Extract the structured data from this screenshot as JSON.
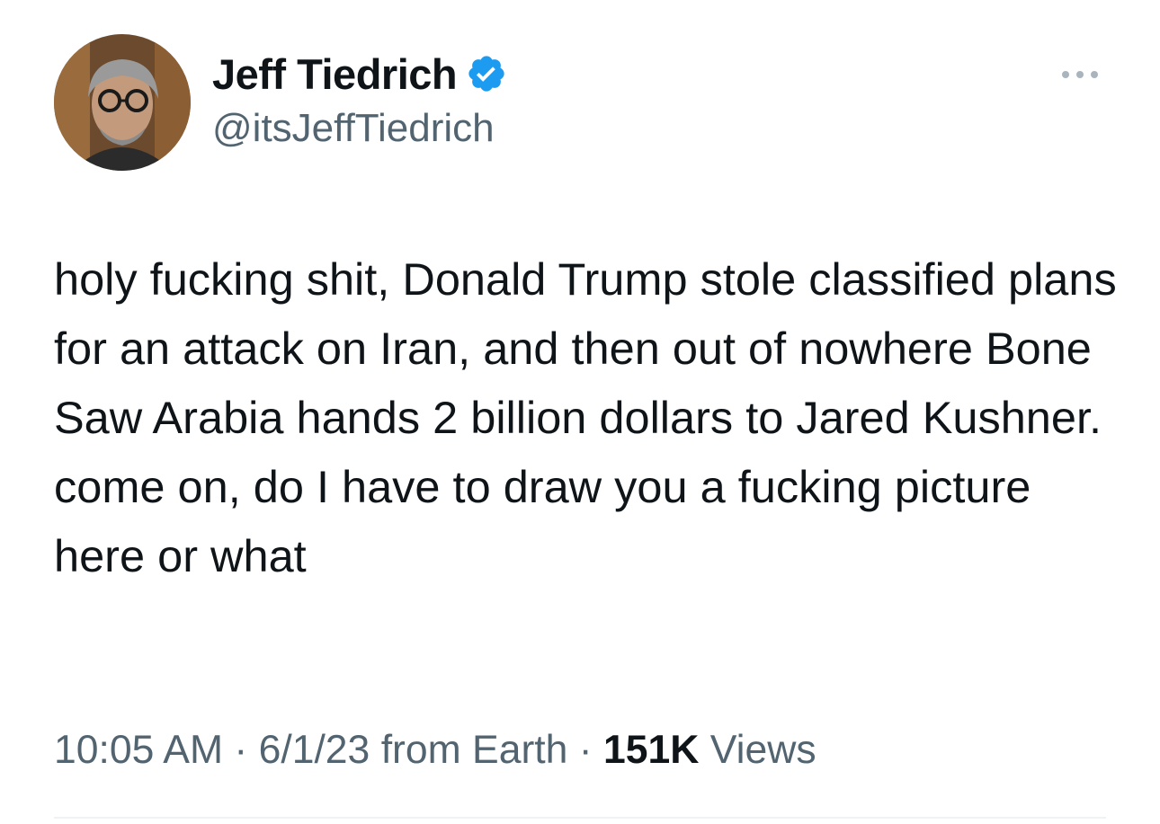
{
  "author": {
    "display_name": "Jeff Tiedrich",
    "handle": "@itsJeffTiedrich",
    "verified_badge_icon": "verified-check-icon",
    "verified_color": "#1d9bf0"
  },
  "tweet": {
    "text": "holy fucking shit, Donald Trump stole classified plans for an attack on Iran, and then out of nowhere Bone Saw Arabia hands 2 billion dollars to Jared Kushner. come on, do I have to draw you a fucking picture here or what"
  },
  "meta": {
    "time": "10:05 AM",
    "separator": " · ",
    "date": "6/1/23",
    "source": "from Earth",
    "views_count": "151K",
    "views_label": "Views"
  },
  "more_options_icon": "more-dots-icon",
  "colors": {
    "text_primary": "#0f1419",
    "text_secondary": "#536471",
    "divider": "#eff3f4"
  }
}
